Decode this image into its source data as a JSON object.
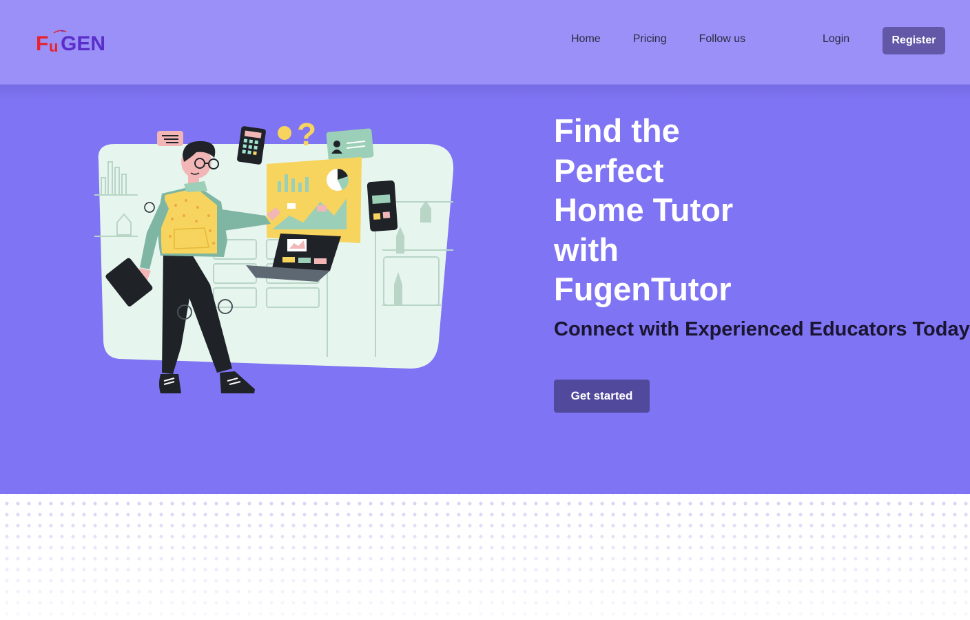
{
  "brand": {
    "logo_text": "FuGEN",
    "colors": {
      "logo_red": "#e8222b",
      "logo_purple": "#5a2ec9"
    }
  },
  "nav": {
    "links": [
      "Home",
      "Pricing",
      "Follow us"
    ],
    "login": "Login",
    "register": "Register"
  },
  "hero": {
    "title_lines": [
      "Find the",
      "Perfect",
      "Home Tutor",
      "with",
      "FugenTutor"
    ],
    "subtitle": "Connect with Experienced Educators Today",
    "cta": "Get started",
    "illustration": "person-presenting-charts-illustration"
  },
  "colors": {
    "navbar": "#9a90f8",
    "hero": "#7f74f3",
    "register_button": "#6358a8",
    "cta_button": "#514a9c",
    "subtitle_text": "#1a1530"
  }
}
